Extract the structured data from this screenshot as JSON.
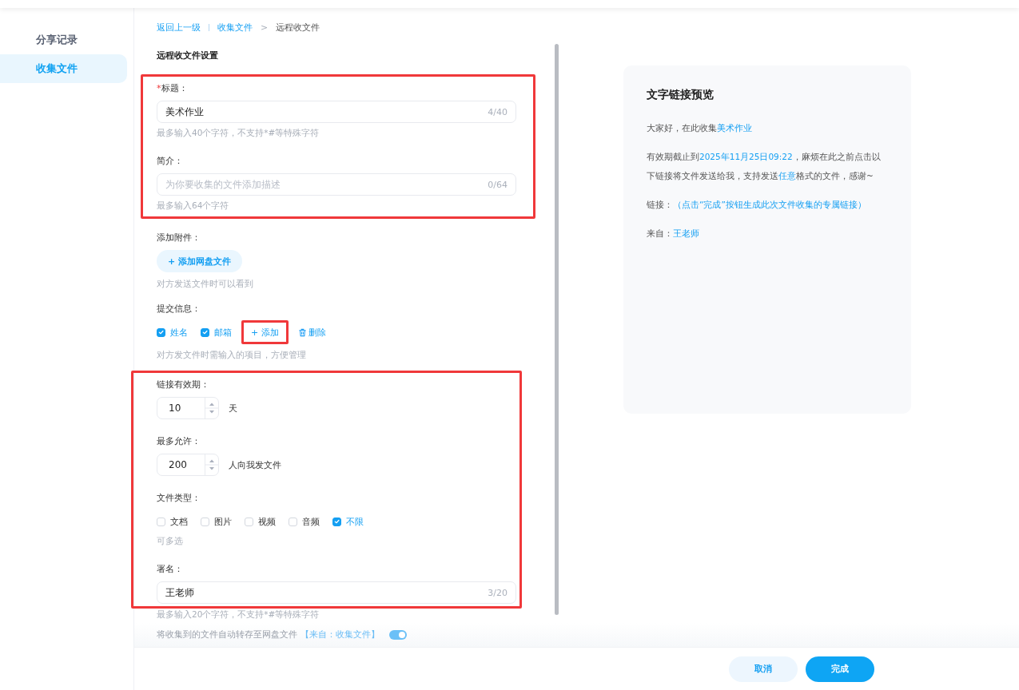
{
  "sidebar": {
    "items": [
      {
        "label": "分享记录",
        "selected": false
      },
      {
        "label": "收集文件",
        "selected": true
      }
    ]
  },
  "breadcrumb": [
    {
      "kind": "link",
      "label": "返回上一级"
    },
    {
      "kind": "divider"
    },
    {
      "kind": "link",
      "label": "收集文件"
    },
    {
      "kind": "arrow",
      "label": ">"
    },
    {
      "kind": "current",
      "label": "远程收文件"
    }
  ],
  "form_title": "远程收文件设置",
  "basic_group_highlighted": true,
  "title_field": {
    "label": "标题：",
    "required": true,
    "required_mark": "*",
    "value": "美术作业",
    "counter": "4/40",
    "hint": "最多输入40个字符，不支持*#等特殊字符"
  },
  "intro_field": {
    "label": "简介：",
    "placeholder": "为你要收集的文件添加描述",
    "counter": "0/64",
    "hint": "最多输入64个字符"
  },
  "attachment": {
    "label": "添加附件：",
    "button": "+ 添加网盘文件",
    "hint": "对方发送文件时可以看到"
  },
  "submit_info": {
    "label": "提交信息：",
    "options": [
      {
        "label": "姓名",
        "checked": true
      },
      {
        "label": "邮箱",
        "checked": true
      }
    ],
    "add_button": "+ 添加",
    "add_highlighted": true,
    "delete_button": "删除",
    "hint": "对方发文件时需输入的项目，方便管理"
  },
  "limits_group_highlighted": true,
  "validity": {
    "label": "链接有效期：",
    "value": "10",
    "unit": "天"
  },
  "max_allowed": {
    "label": "最多允许：",
    "value": "200",
    "unit": "人向我发文件"
  },
  "file_types": {
    "label": "文件类型：",
    "options": [
      {
        "label": "文档",
        "checked": false
      },
      {
        "label": "图片",
        "checked": false
      },
      {
        "label": "视频",
        "checked": false
      },
      {
        "label": "音频",
        "checked": false
      },
      {
        "label": "不限",
        "checked": true
      }
    ],
    "hint": "可多选"
  },
  "signature": {
    "label": "署名：",
    "value": "王老师",
    "counter": "3/20",
    "hint": "最多输入20个字符，不支持*#等特殊字符"
  },
  "auto_save": {
    "text": "将收集到的文件自动转存至网盘文件",
    "link": "【来自：收集文件】",
    "on": true
  },
  "preview": {
    "title": "文字链接预览",
    "paragraphs": [
      [
        {
          "text": "大家好，在此收集",
          "highlight": false
        },
        {
          "text": "美术作业",
          "highlight": true
        }
      ],
      [
        {
          "text": "有效期截止到",
          "highlight": false
        },
        {
          "text": "2025年11月25日09:22",
          "highlight": true
        },
        {
          "text": "，麻烦在此之前点击以下链接将文件发送给我，支持发送",
          "highlight": false
        },
        {
          "text": "任意",
          "highlight": true
        },
        {
          "text": "格式的文件，感谢~",
          "highlight": false
        }
      ],
      [
        {
          "text": "链接：",
          "highlight": false
        },
        {
          "text": "（点击“完成”按钮生成此次文件收集的专属链接）",
          "highlight": true
        }
      ],
      [
        {
          "text": "来自：",
          "highlight": false
        },
        {
          "text": "王老师",
          "highlight": true
        }
      ]
    ]
  },
  "footer": {
    "buttons": [
      {
        "label": "取消",
        "kind": "secondary"
      },
      {
        "label": "完成",
        "kind": "primary"
      }
    ]
  }
}
